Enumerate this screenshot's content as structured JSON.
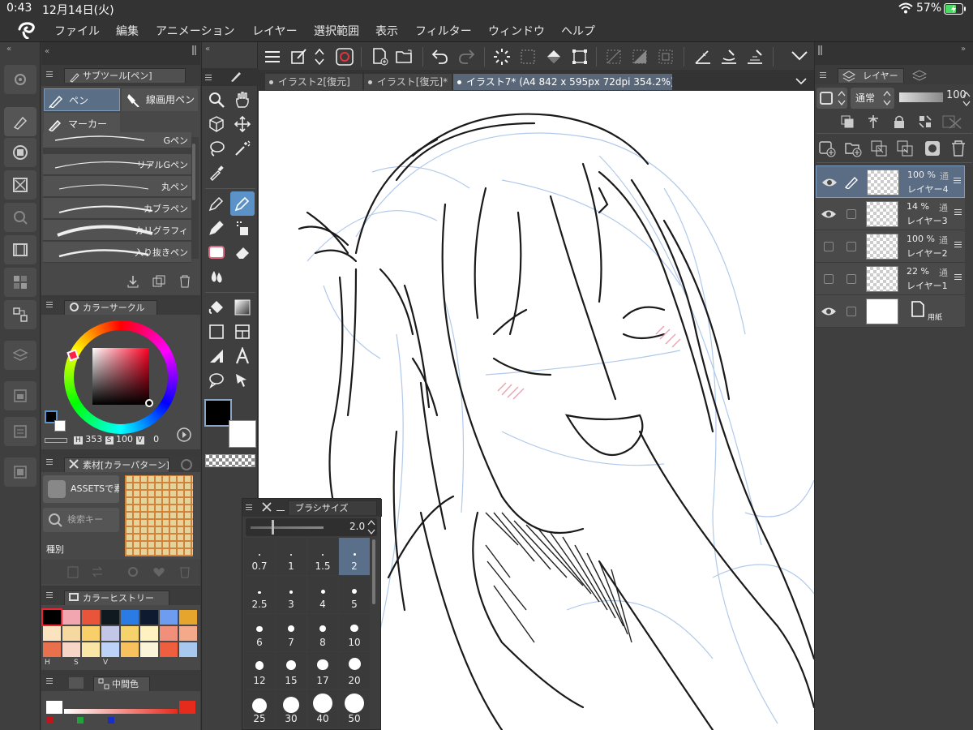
{
  "status": {
    "time": "0:43",
    "date": "12月14日(火)",
    "battery": "57%"
  },
  "menu": [
    "ファイル",
    "編集",
    "アニメーション",
    "レイヤー",
    "選択範囲",
    "表示",
    "フィルター",
    "ウィンドウ",
    "ヘルプ"
  ],
  "subtool": {
    "title": "サブツール[ペン]",
    "groups": [
      "ペン",
      "線画用ペン",
      "マーカー"
    ],
    "brushes": [
      "Gペン",
      "リアルGペン",
      "丸ペン",
      "カブラペン",
      "カリグラフィ",
      "入り抜きペン"
    ]
  },
  "color_circle": {
    "title": "カラーサークル",
    "h": "353",
    "s": "100",
    "v": "0",
    "h_label": "H",
    "s_label": "S",
    "v_label": "V"
  },
  "material": {
    "title": "素材[カラーパターン]",
    "assets": "ASSETSで素",
    "search": "検索キー",
    "kind": "種別"
  },
  "color_history": {
    "title": "カラーヒストリー",
    "labels": [
      "H",
      "S",
      "V"
    ],
    "colors": [
      "#000000",
      "#f2a7b0",
      "#e8553a",
      "#101820",
      "#2a7be4",
      "#0d1a30",
      "#6e9cf0",
      "#e6a52c",
      "#fbe3c0",
      "#f6d9a0",
      "#f8cf69",
      "#c4c6e8",
      "#f5d26a",
      "#fff2c0",
      "#f0907a",
      "#f4a98a",
      "#e8704c",
      "#f7d5c7",
      "#f9e6a6",
      "#bcd3f7",
      "#f7c25d",
      "#fbf4d8",
      "#ef5e3f",
      "#a8c8f0"
    ]
  },
  "intermediate": {
    "title": "中間色"
  },
  "tabs": [
    "イラスト2[復元]",
    "イラスト[復元]*",
    "イラスト7* (A4 842 x 595px 72dpi 354.2%)"
  ],
  "brush_size": {
    "title": "ブラシサイズ",
    "value": "2.0",
    "sizes": [
      "0.7",
      "1",
      "1.5",
      "2",
      "2.5",
      "3",
      "4",
      "5",
      "6",
      "7",
      "8",
      "10",
      "12",
      "15",
      "17",
      "20",
      "25",
      "30",
      "40",
      "50"
    ],
    "selected": "2"
  },
  "layer_panel": {
    "title": "レイヤー",
    "blend": "通常",
    "opacity": "100",
    "layers": [
      {
        "pct": "100 %",
        "mode": "通",
        "name": "レイヤー4",
        "visible": true,
        "selected": true
      },
      {
        "pct": "14 %",
        "mode": "通",
        "name": "レイヤー3",
        "visible": true,
        "selected": false
      },
      {
        "pct": "100 %",
        "mode": "通",
        "name": "レイヤー2",
        "visible": false,
        "selected": false
      },
      {
        "pct": "22 %",
        "mode": "通",
        "name": "レイヤー1",
        "visible": false,
        "selected": false
      },
      {
        "pct": "",
        "mode": "",
        "name": "用紙",
        "visible": true,
        "selected": false
      }
    ]
  },
  "colors": {
    "accent": "#5b93c9",
    "panel": "#484848",
    "bg": "#3a3a3a",
    "main_color": "#000000",
    "sub_color": "#ffffff"
  }
}
